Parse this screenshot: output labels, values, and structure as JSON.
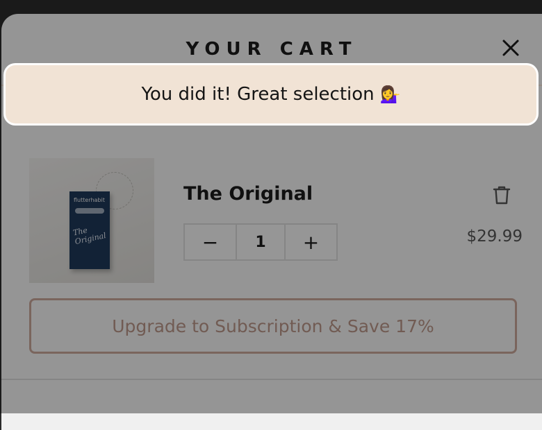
{
  "cart": {
    "title": "YOUR CART"
  },
  "banner": {
    "text": "You did it! Great selection",
    "emoji": "💁‍♀️"
  },
  "item": {
    "name": "The Original",
    "quantity": "1",
    "price": "$29.99",
    "decrement_label": "−",
    "increment_label": "+",
    "image_brand": "flutterhabit",
    "image_script": "The Original"
  },
  "upgrade": {
    "label": "Upgrade to Subscription & Save 17%"
  },
  "icons": {
    "close": "close-icon",
    "trash": "trash-icon"
  },
  "colors": {
    "banner_bg": "#f1e3d5",
    "accent_border": "#c6a496",
    "box_navy": "#1d3758"
  }
}
